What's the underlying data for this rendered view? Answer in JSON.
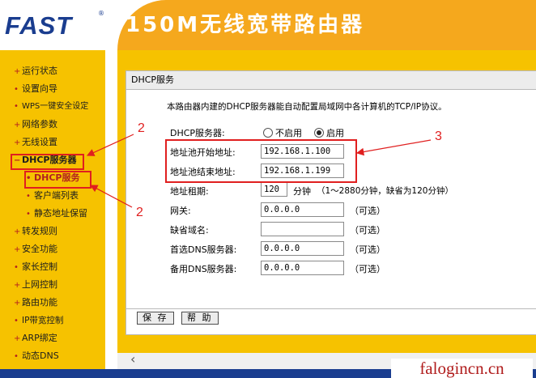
{
  "header": {
    "logo": "FAST",
    "trademark": "®",
    "title": "150M无线宽带路由器"
  },
  "sidebar": {
    "items": [
      {
        "label": "运行状态",
        "bullet": "+"
      },
      {
        "label": "设置向导",
        "bullet": "•"
      },
      {
        "label": "WPS一键安全设定",
        "bullet": "•"
      },
      {
        "label": "网络参数",
        "bullet": "+"
      },
      {
        "label": "无线设置",
        "bullet": "+"
      },
      {
        "label": "DHCP服务器",
        "bullet": "−"
      },
      {
        "label": "DHCP服务",
        "bullet": "•"
      },
      {
        "label": "客户端列表",
        "bullet": "•"
      },
      {
        "label": "静态地址保留",
        "bullet": "•"
      },
      {
        "label": "转发规则",
        "bullet": "+"
      },
      {
        "label": "安全功能",
        "bullet": "+"
      },
      {
        "label": "家长控制",
        "bullet": "•"
      },
      {
        "label": "上网控制",
        "bullet": "+"
      },
      {
        "label": "路由功能",
        "bullet": "+"
      },
      {
        "label": "IP带宽控制",
        "bullet": "•"
      },
      {
        "label": "ARP绑定",
        "bullet": "+"
      },
      {
        "label": "动态DNS",
        "bullet": "•"
      }
    ]
  },
  "panel": {
    "title": "DHCP服务",
    "description": "本路由器内建的DHCP服务器能自动配置局域网中各计算机的TCP/IP协议。",
    "dhcp_server": {
      "label": "DHCP服务器:",
      "option_off": "不启用",
      "option_on": "启用",
      "selected": "启用"
    },
    "start_addr": {
      "label": "地址池开始地址:",
      "value": "192.168.1.100"
    },
    "end_addr": {
      "label": "地址池结束地址:",
      "value": "192.168.1.199"
    },
    "lease": {
      "label": "地址租期:",
      "value": "120",
      "unit": "分钟",
      "hint": "（1～2880分钟，缺省为120分钟）"
    },
    "gateway": {
      "label": "网关:",
      "value": "0.0.0.0",
      "hint": "（可选）"
    },
    "domain": {
      "label": "缺省域名:",
      "value": "",
      "hint": "（可选）"
    },
    "dns1": {
      "label": "首选DNS服务器:",
      "value": "0.0.0.0",
      "hint": "（可选）"
    },
    "dns2": {
      "label": "备用DNS服务器:",
      "value": "0.0.0.0",
      "hint": "（可选）"
    },
    "buttons": {
      "save": "保 存",
      "help": "帮 助"
    }
  },
  "annotations": {
    "n2a": "2",
    "n2b": "2",
    "n3": "3"
  },
  "watermark": "falogincn.cn",
  "colors": {
    "accent": "#f6c200",
    "brand_blue": "#1a3d8f",
    "annotation_red": "#e01f1f",
    "banner_orange": "#f5a81d"
  }
}
